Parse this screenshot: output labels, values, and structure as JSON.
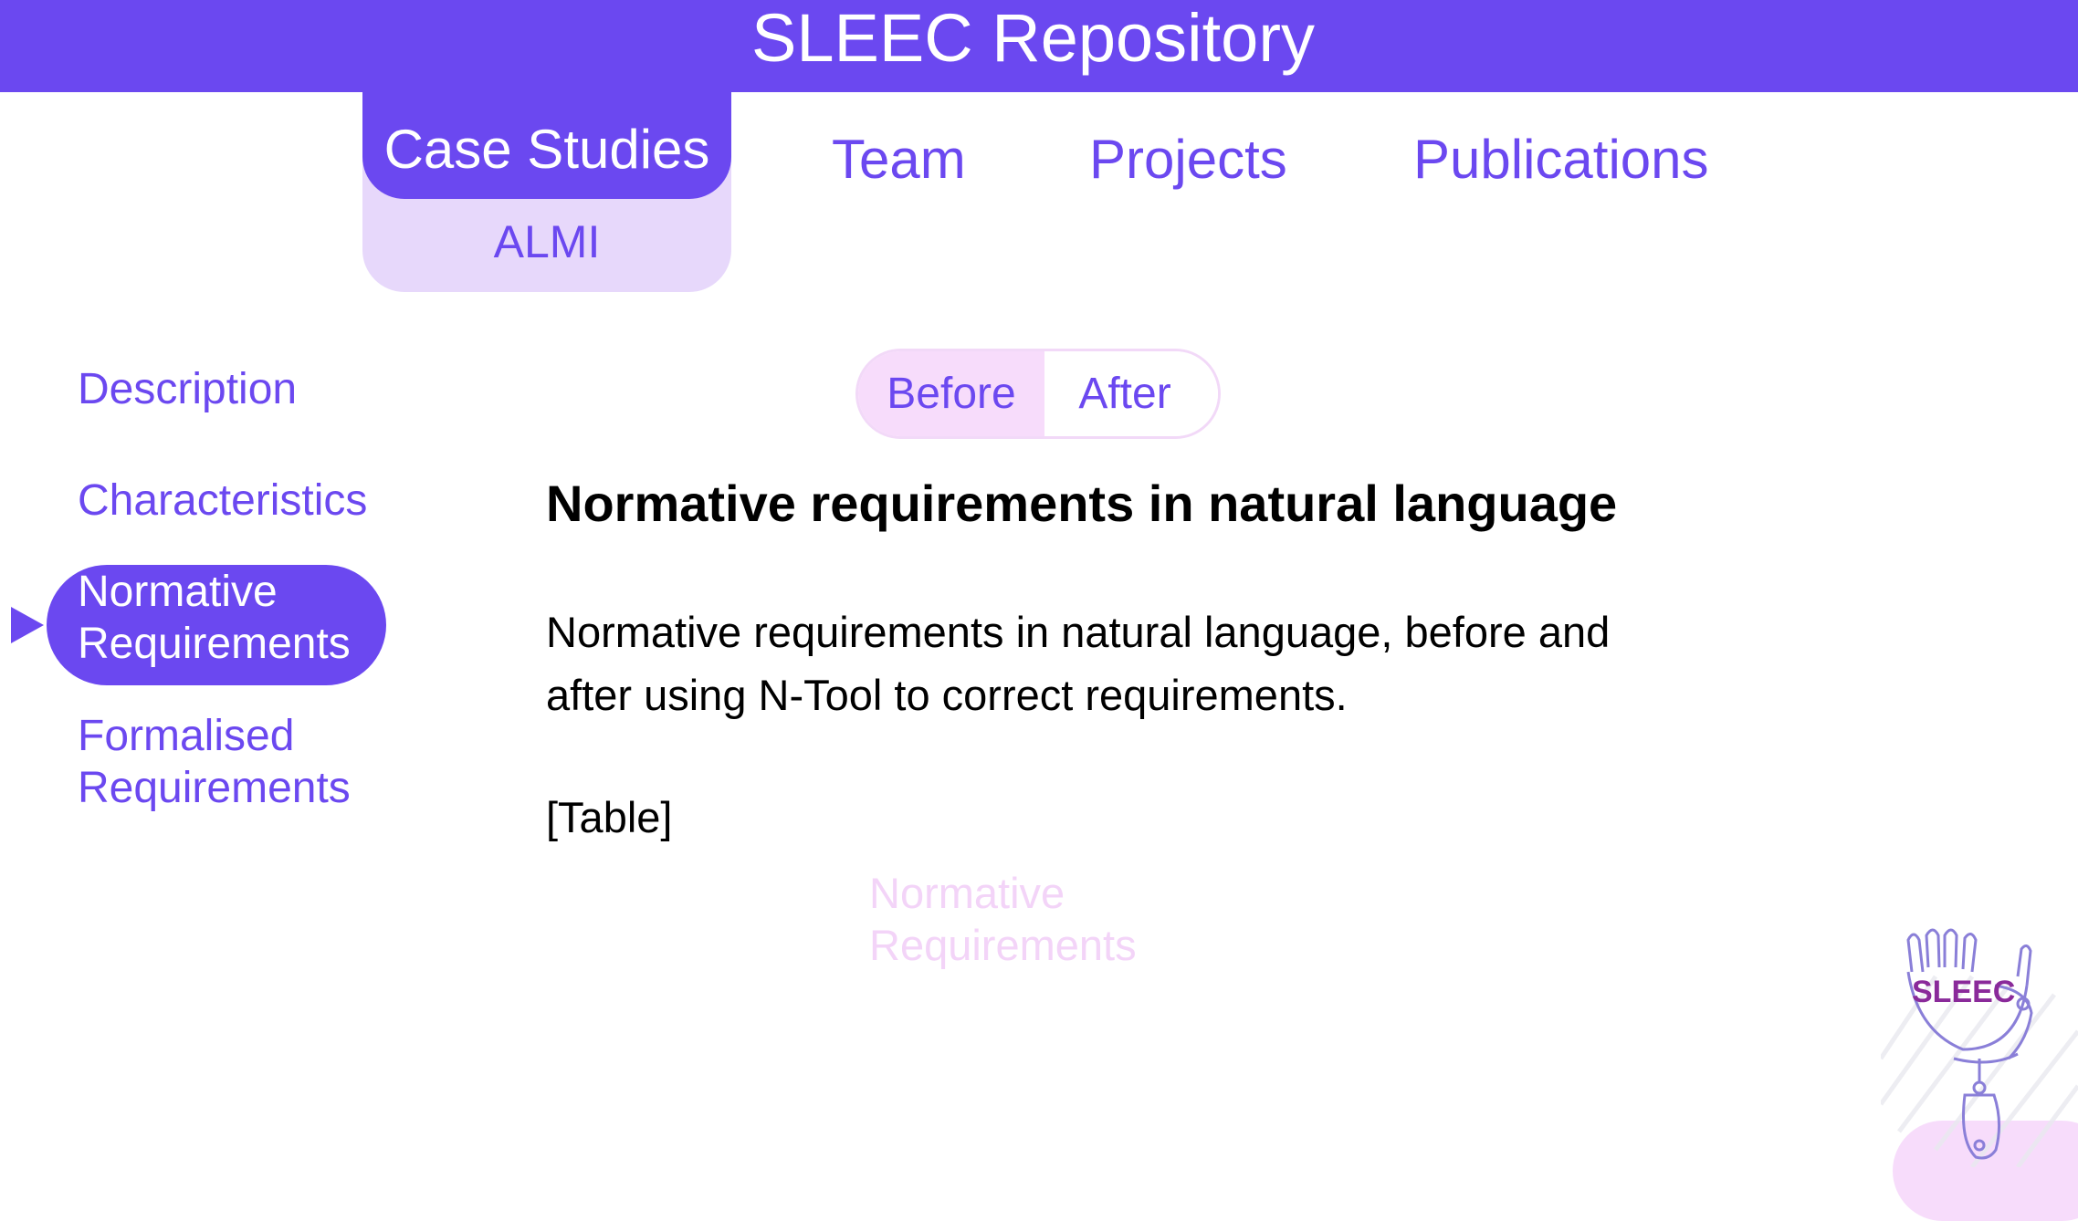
{
  "header": {
    "title": "SLEEC Repository"
  },
  "nav": {
    "case_studies": "Case Studies",
    "case_studies_sub": "ALMI",
    "team": "Team",
    "projects": "Projects",
    "publications": "Publications"
  },
  "sidebar": {
    "items": [
      {
        "label": "Description"
      },
      {
        "label": "Characteristics"
      },
      {
        "label_line1": "Normative",
        "label_line2": "Requirements"
      },
      {
        "label_line1": "Formalised",
        "label_line2": "Requirements"
      }
    ]
  },
  "toggle": {
    "before": "Before",
    "after": "After",
    "selected": "Before"
  },
  "content": {
    "title": "Normative requirements in natural language",
    "body": "Normative requirements in natural language, before and after using N-Tool to correct requirements.",
    "table_placeholder": "[Table]",
    "ghost_line1": "Normative",
    "ghost_line2": "Requirements"
  },
  "logo": {
    "text": "SLEEC"
  },
  "colors": {
    "brand_purple": "#6b48f0",
    "light_lavender": "#e7d8fb",
    "light_pink": "#f7dcfb",
    "logo_purple": "#8a2a9a"
  }
}
